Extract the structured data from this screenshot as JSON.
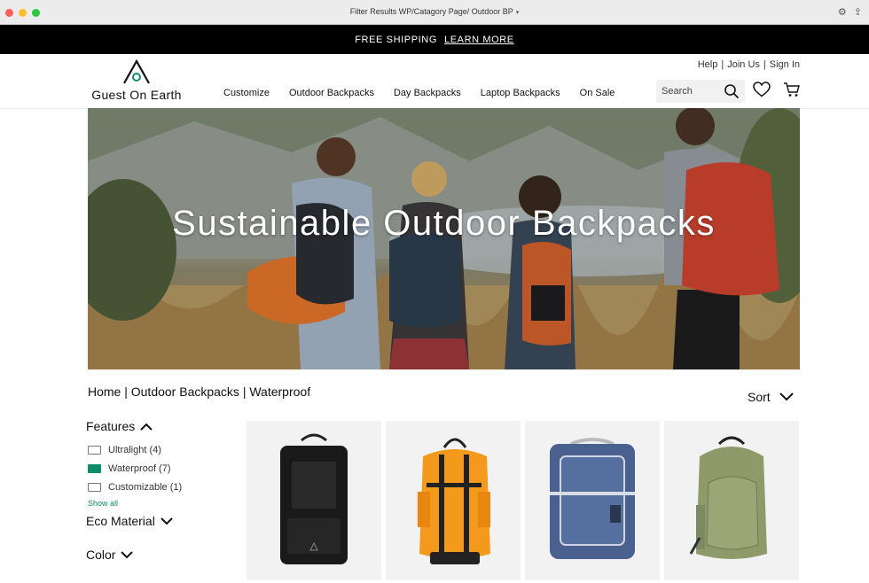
{
  "window": {
    "title": "Filter Results WP/Catagory Page/ Outdoor BP",
    "caret": "▾"
  },
  "promo": {
    "text": "FREE SHIPPING",
    "link": "LEARN MORE"
  },
  "brand": {
    "name": "Guest On Earth"
  },
  "utility": {
    "help": "Help",
    "sep1": "|",
    "join": "Join Us",
    "sep2": "|",
    "signin": "Sign In"
  },
  "nav": [
    "Customize",
    "Outdoor Backpacks",
    "Day Backpacks",
    "Laptop Backpacks",
    "On Sale"
  ],
  "search": {
    "placeholder": "Search"
  },
  "hero": {
    "title": "Sustainable Outdoor Backpacks"
  },
  "breadcrumb": "Home | Outdoor Backpacks | Waterproof",
  "sort": {
    "label": "Sort"
  },
  "filters": {
    "features": {
      "title": "Features",
      "options": [
        {
          "label": "Ultralight (4)",
          "checked": false
        },
        {
          "label": "Waterproof (7)",
          "checked": true
        },
        {
          "label": "Customizable (1)",
          "checked": false
        }
      ],
      "show_all": "Show all"
    },
    "eco": {
      "title": "Eco Material"
    },
    "color": {
      "title": "Color"
    }
  },
  "products": [
    {
      "name": "black-backpack",
      "color": "#1a1a1a"
    },
    {
      "name": "orange-backpack",
      "color": "#f39a1c"
    },
    {
      "name": "blue-backpack",
      "color": "#4a6190"
    },
    {
      "name": "green-backpack",
      "color": "#8e9a6a"
    }
  ],
  "accent": "#0f8d68"
}
